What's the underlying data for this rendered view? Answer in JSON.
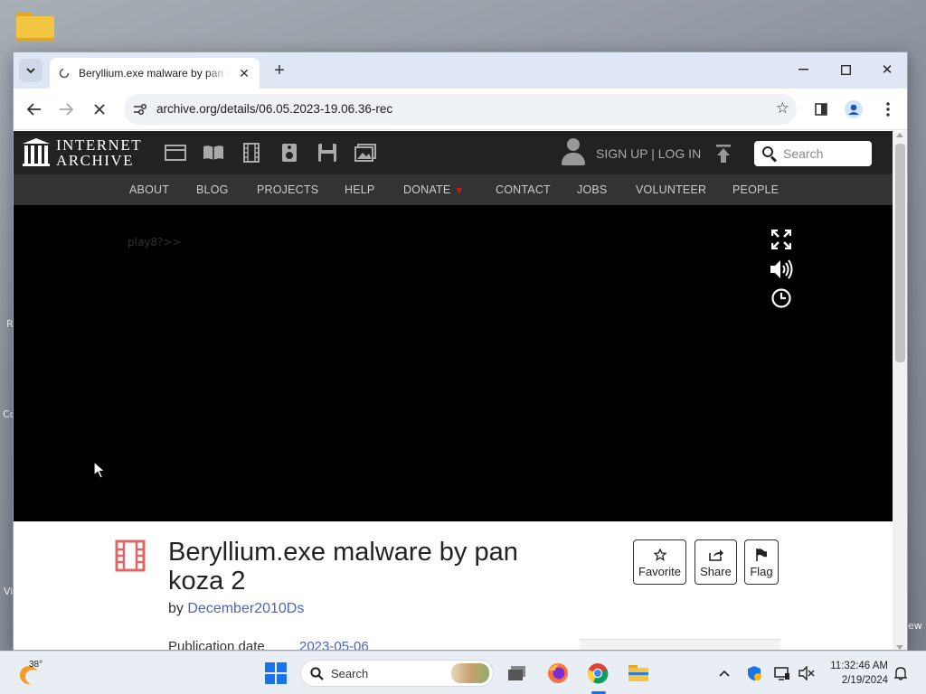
{
  "browser": {
    "tab_title": "Beryllium.exe malware by pan koza 2",
    "url": "archive.org/details/06.05.2023-19.06.36-rec"
  },
  "site": {
    "logo_line1": "INTERNET",
    "logo_line2": "ARCHIVE",
    "media_icons": [
      "web-icon",
      "texts-icon",
      "video-icon",
      "audio-icon",
      "software-icon",
      "images-icon"
    ],
    "signup_label": "SIGN UP | LOG IN",
    "search_placeholder": "Search",
    "nav": [
      "ABOUT",
      "BLOG",
      "PROJECTS",
      "HELP",
      "DONATE",
      "CONTACT",
      "JOBS",
      "VOLUNTEER",
      "PEOPLE"
    ]
  },
  "player": {
    "text": "play8?>>"
  },
  "item": {
    "title": "Beryllium.exe malware by pan koza 2",
    "by_label": "by",
    "author": "December2010Ds",
    "pubdate_label": "Publication date",
    "pubdate_value": "2023-05-06",
    "actions": [
      "Favorite",
      "Share",
      "Flag"
    ]
  },
  "taskbar": {
    "temperature": "38°",
    "search_label": "Search",
    "time": "11:32:46 AM",
    "date": "2/19/2024"
  },
  "colors": {
    "accent": "#1a73e8",
    "link": "#4b64c2",
    "heart": "#dd1111",
    "film_icon": "#e06666"
  }
}
